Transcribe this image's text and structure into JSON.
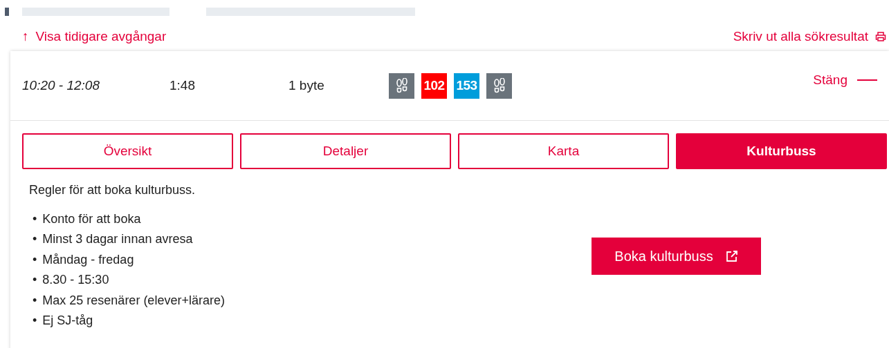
{
  "earlier_link": {
    "arrow": "↑",
    "label": "Visa tidigare avgångar"
  },
  "print_link": {
    "label": "Skriv ut alla sökresultat"
  },
  "trip": {
    "time": "10:20 - 12:08",
    "duration": "1:48",
    "changes": "1 byte",
    "expanded": true,
    "close_label": "Stäng",
    "legs": [
      {
        "kind": "walk"
      },
      {
        "kind": "bus",
        "label": "102",
        "color": "#ff0000"
      },
      {
        "kind": "bus",
        "label": "153",
        "color": "#009ddb"
      },
      {
        "kind": "walk"
      }
    ]
  },
  "tabs": [
    {
      "label": "Översikt",
      "selected": false
    },
    {
      "label": "Detaljer",
      "selected": false
    },
    {
      "label": "Karta",
      "selected": false
    },
    {
      "label": "Kulturbuss",
      "selected": true
    }
  ],
  "rules": {
    "intro": "Regler för att boka kulturbuss.",
    "items": [
      {
        "bullet": "•",
        "text": "Konto för att boka"
      },
      {
        "bullet": "•",
        "text": "Minst 3 dagar innan avresa"
      },
      {
        "bullet": "•",
        "text": "Måndag - fredag"
      },
      {
        "bullet": "•",
        "text": "8.30 - 15:30"
      },
      {
        "bullet": "•",
        "text": "Max 25 resenärer (elever+lärare)"
      },
      {
        "bullet": "•",
        "text": "Ej SJ-tåg"
      }
    ]
  },
  "book_button": {
    "label": "Boka kulturbuss"
  }
}
